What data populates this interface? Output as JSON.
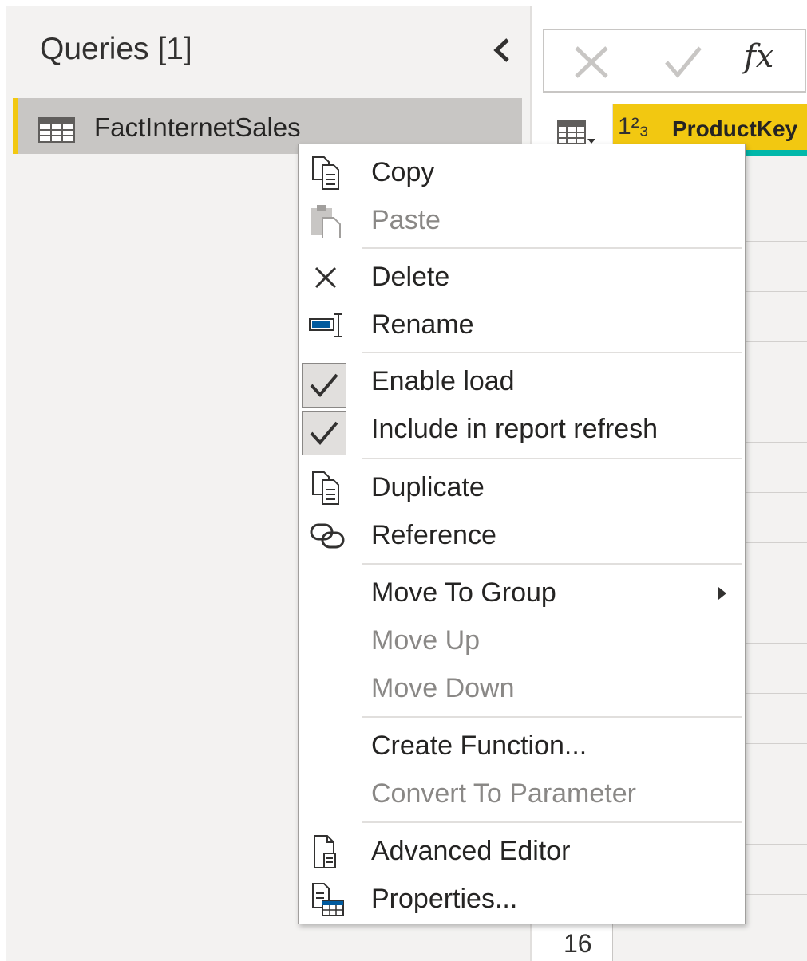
{
  "queries_pane": {
    "title": "Queries [1]",
    "collapse_icon": "chevron-left-icon",
    "queries": [
      {
        "label": "FactInternetSales",
        "icon": "table-icon",
        "selected": true
      }
    ]
  },
  "formula_bar": {
    "cancel_icon": "close-icon",
    "commit_icon": "checkmark-icon",
    "fx_label": "fx"
  },
  "grid": {
    "column_type_label": "1²₃",
    "column_name": "ProductKey",
    "visible_row_number": "16",
    "accent_color": "#f2c811",
    "quality_bar_color": "#01b8aa"
  },
  "context_menu": {
    "items": [
      {
        "label": "Copy",
        "icon": "copy-icon",
        "enabled": true
      },
      {
        "label": "Paste",
        "icon": "paste-icon",
        "enabled": false
      },
      {
        "label": "Delete",
        "icon": "delete-x-icon",
        "enabled": true
      },
      {
        "label": "Rename",
        "icon": "rename-icon",
        "enabled": true
      },
      {
        "label": "Enable load",
        "icon": "checkbox-checked-icon",
        "enabled": true,
        "checked": true
      },
      {
        "label": "Include in report refresh",
        "icon": "checkbox-checked-icon",
        "enabled": true,
        "checked": true
      },
      {
        "label": "Duplicate",
        "icon": "duplicate-icon",
        "enabled": true
      },
      {
        "label": "Reference",
        "icon": "link-icon",
        "enabled": true
      },
      {
        "label": "Move To Group",
        "icon": "",
        "enabled": true,
        "submenu": true
      },
      {
        "label": "Move Up",
        "icon": "",
        "enabled": false
      },
      {
        "label": "Move Down",
        "icon": "",
        "enabled": false
      },
      {
        "label": "Create Function...",
        "icon": "",
        "enabled": true
      },
      {
        "label": "Convert To Parameter",
        "icon": "",
        "enabled": false
      },
      {
        "label": "Advanced Editor",
        "icon": "advanced-editor-icon",
        "enabled": true
      },
      {
        "label": "Properties...",
        "icon": "properties-icon",
        "enabled": true
      }
    ]
  }
}
